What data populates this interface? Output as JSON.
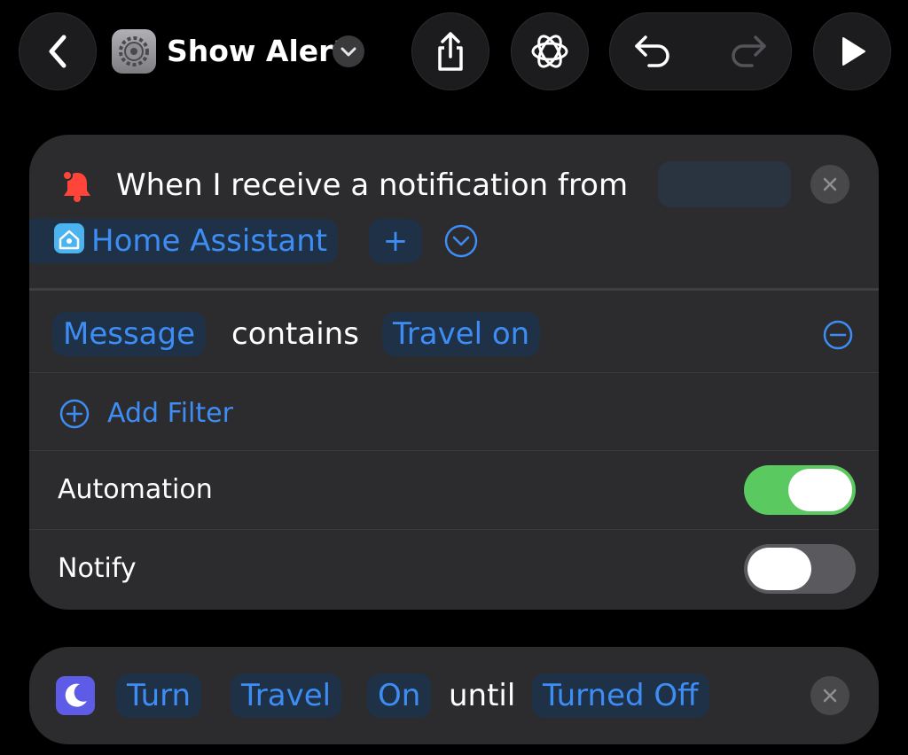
{
  "header": {
    "title": "Show Alert",
    "back_icon": "chevron-left-icon",
    "app_icon": "gear-icon",
    "title_menu_icon": "chevron-down-icon",
    "share_icon": "share-icon",
    "intelligence_icon": "apple-intelligence-icon",
    "undo_icon": "undo-icon",
    "redo_icon": "redo-icon",
    "run_icon": "play-icon"
  },
  "trigger": {
    "icon": "bell-badge-icon",
    "text": "When I receive a notification from",
    "app_name": "Home Assistant",
    "add_label": "+",
    "filter": {
      "field": "Message",
      "operator": "contains",
      "value": "Travel on"
    },
    "add_filter_label": "Add Filter",
    "automation_label": "Automation",
    "automation_enabled": true,
    "notify_label": "Notify",
    "notify_enabled": false
  },
  "action": {
    "icon": "moon-icon",
    "verb": "Turn",
    "focus": "Travel",
    "state": "On",
    "connector": "until",
    "duration": "Turned Off"
  },
  "colors": {
    "accent": "#3d8df5",
    "toggle_on": "#5ac95f",
    "toggle_off": "#5a5a5e",
    "card": "#2c2c2e",
    "token_bg": "#1e3146",
    "bell": "#ff453a",
    "focus_icon": "#5e5ce6"
  }
}
